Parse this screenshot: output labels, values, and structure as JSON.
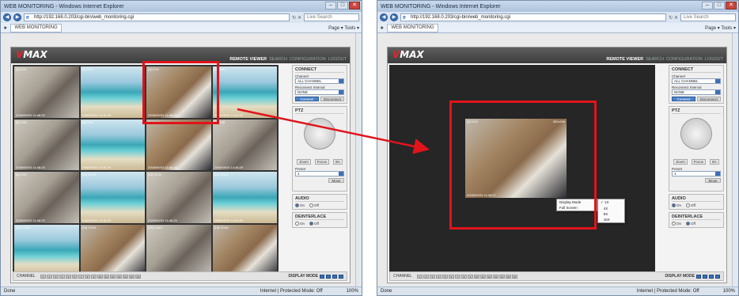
{
  "browser": {
    "title": "WEB MONITORING - Windows Internet Explorer",
    "url": "http://192.168.0.203/cgi-bin/web_monitoring.cgi",
    "search_placeholder": "Live Search",
    "tab_label": "WEB MONITORING",
    "tools_menu": "Page ▾  Tools ▾",
    "status_left": "Done",
    "status_zone": "Internet | Protected Mode: Off",
    "zoom": "100%"
  },
  "app": {
    "logo_v": "V",
    "logo_rest": "MAX",
    "menu": [
      "REMOTE VIEWER",
      "SEARCH",
      "CONFIGURATION",
      "LOGOUT"
    ],
    "connect_title": "CONNECT",
    "channel_label": "Channel",
    "channel_value": "ALL CHANNEL",
    "reconnect_label": "Reconnect Interval",
    "reconnect_value": "NONE",
    "connect_btn": "Connect",
    "disconnect_btn": "Disconnect",
    "ptz_title": "PTZ",
    "zoom_btns": [
      "Zoom",
      "Focus",
      "Iris"
    ],
    "preset_label": "Preset",
    "preset_value": "1",
    "move_btn": "Move",
    "audio_title": "AUDIO",
    "deint_title": "DEINTERLACE",
    "on_label": "On",
    "off_label": "Off",
    "channel_bar": "CHANNEL",
    "display_mode_bar": "DISPLAY MODE",
    "channel_buttons": [
      "1",
      "2",
      "3",
      "4",
      "5",
      "6",
      "7",
      "8",
      "9",
      "10",
      "11",
      "12",
      "13",
      "14",
      "15",
      "16"
    ]
  },
  "cameras": [
    {
      "label": "[1] CH1",
      "ts": "2008/09/03 14:46:29",
      "scene": "room"
    },
    {
      "label": "[2] CH2",
      "ts": "2008/09/03 14:46:29",
      "scene": "beach"
    },
    {
      "label": "[3] CH3",
      "ts": "2008/09/03 14:46:29",
      "scene": "office"
    },
    {
      "label": "[4] CH4",
      "ts": "2008/09/03 14:46:29",
      "scene": "beach"
    },
    {
      "label": "[5] CH5",
      "ts": "2008/09/03 14:46:29",
      "scene": "room"
    },
    {
      "label": "[6] CH6",
      "ts": "2008/09/03 14:46:29",
      "scene": "beach"
    },
    {
      "label": "[7] CH7",
      "ts": "2008/09/03 14:46:29",
      "scene": "office"
    },
    {
      "label": "[8] CH8",
      "ts": "2008/09/03 14:46:29",
      "scene": "room"
    },
    {
      "label": "[9] CH9",
      "ts": "2008/09/03 14:46:29",
      "scene": "room"
    },
    {
      "label": "[10] CH10",
      "ts": "2008/09/03 14:46:29",
      "scene": "beach"
    },
    {
      "label": "[11] CH11",
      "ts": "2008/09/03 14:46:29",
      "scene": "room"
    },
    {
      "label": "[12] CH12",
      "ts": "2008/09/03 14:46:29",
      "scene": "beach"
    },
    {
      "label": "[13] CH13",
      "ts": "2008/09/03 14:46:29",
      "scene": "beach"
    },
    {
      "label": "[14] CH14",
      "ts": "2008/09/03 14:46:29",
      "scene": "office"
    },
    {
      "label": "[15] CH15",
      "ts": "2008/09/03 14:46:29",
      "scene": "room"
    },
    {
      "label": "[16] CH16",
      "ts": "2008/09/03 14:46:29",
      "scene": "office"
    }
  ],
  "single_view": {
    "label": "[3] CH3",
    "res": "352x288",
    "ts": "2008/09/03 14:46:07"
  },
  "context_menu": {
    "items": [
      "Display Mode",
      "Full Screen"
    ],
    "sub_items": [
      "1X",
      "4X",
      "8X",
      "16X"
    ],
    "checked": "1X"
  },
  "colors": {
    "highlight": "#e0141b",
    "accent": "#3d6fb5"
  }
}
